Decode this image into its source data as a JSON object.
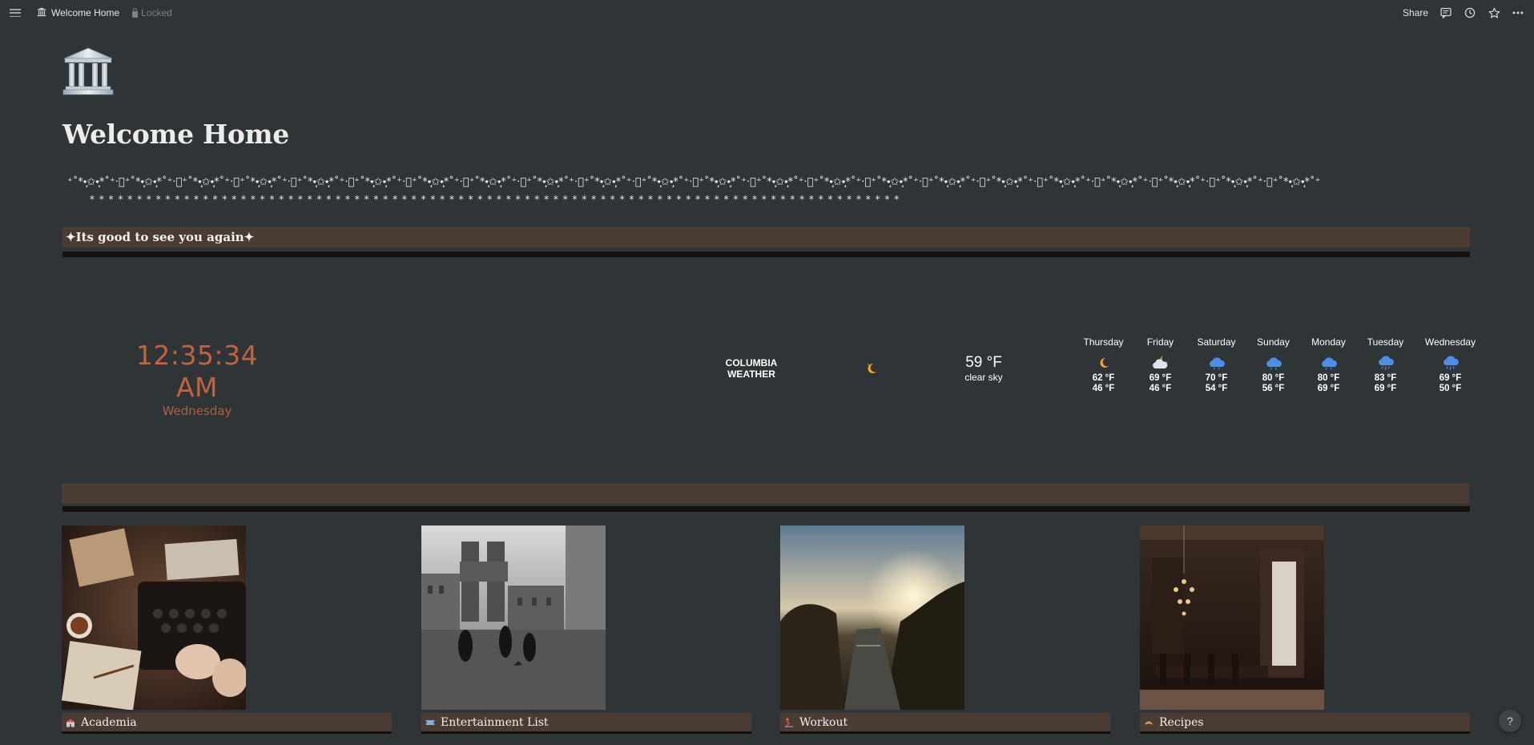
{
  "topbar": {
    "menu_icon": "hamburger-icon",
    "breadcrumb_icon": "classical-building-icon",
    "breadcrumb_title": "Welcome Home",
    "locked_label": "Locked",
    "share_label": "Share",
    "icons": [
      "comment-icon",
      "clock-icon",
      "star-icon",
      "more-icon"
    ]
  },
  "page": {
    "icon": "classical-building-icon",
    "title": "Welcome Home",
    "divider_row1": "⁺˚*•̩̩͙✩•̩̩͙*˚⁺‧͙⁺˚*•̩̩͙✩•̩̩͙*˚⁺‧͙⁺˚*•̩̩͙✩•̩̩͙*˚⁺‧͙⁺˚*•̩̩͙✩•̩̩͙*˚⁺‧͙⁺˚*•̩̩͙✩•̩̩͙*˚⁺‧͙⁺˚*•̩̩͙✩•̩̩͙*˚⁺‧͙⁺˚*•̩̩͙✩•̩̩͙*˚⁺‧͙⁺˚*•̩̩͙✩•̩̩͙*˚⁺‧͙⁺˚*•̩̩͙✩•̩̩͙*˚⁺‧͙⁺˚*•̩̩͙✩•̩̩͙*˚⁺‧͙⁺˚*•̩̩͙✩•̩̩͙*˚⁺‧͙⁺˚*•̩̩͙✩•̩̩͙*˚⁺‧͙⁺˚*•̩̩͙✩•̩̩͙*˚⁺‧͙⁺˚*•̩̩͙✩•̩̩͙*˚⁺‧͙⁺˚*•̩̩͙✩•̩̩͙*˚⁺‧͙⁺˚*•̩̩͙✩•̩̩͙*˚⁺‧͙⁺˚*•̩̩͙✩•̩̩͙*˚⁺‧͙⁺˚*•̩̩͙✩•̩̩͙*˚⁺‧͙⁺˚*•̩̩͙✩•̩̩͙*˚⁺‧͙⁺˚*•̩̩͙✩•̩̩͙*˚⁺‧͙⁺˚*•̩̩͙✩•̩̩͙*˚⁺‧͙⁺˚*•̩̩͙✩•̩̩͙*˚⁺",
    "divider_row2": "⁎ ⁎ ⁎ ⁎ ⁎ ⁎ ⁎ ⁎ ⁎ ⁎ ⁎ ⁎ ⁎ ⁎ ⁎ ⁎ ⁎ ⁎ ⁎ ⁎ ⁎ ⁎ ⁎ ⁎ ⁎ ⁎ ⁎ ⁎ ⁎ ⁎ ⁎ ⁎ ⁎ ⁎ ⁎ ⁎ ⁎ ⁎ ⁎ ⁎ ⁎ ⁎ ⁎ ⁎ ⁎ ⁎ ⁎ ⁎ ⁎ ⁎ ⁎ ⁎ ⁎ ⁎ ⁎ ⁎ ⁎ ⁎ ⁎ ⁎ ⁎ ⁎ ⁎ ⁎ ⁎ ⁎ ⁎ ⁎ ⁎ ⁎ ⁎ ⁎ ⁎ ⁎ ⁎ ⁎ ⁎ ⁎ ⁎ ⁎ ⁎ ⁎ ⁎ ⁎ ⁎ ⁎",
    "greeting": "✦Its good to see you again✦"
  },
  "clock": {
    "time": "12:35:34 AM",
    "day": "Wednesday"
  },
  "weather": {
    "city_line1": "COLUMBIA",
    "city_line2": "WEATHER",
    "current_icon": "crescent-moon-icon",
    "current_temp": "59 °F",
    "current_desc": "clear sky",
    "forecast": [
      {
        "day": "Thursday",
        "icon": "crescent-moon-icon",
        "hi": "62 °F",
        "lo": "46 °F"
      },
      {
        "day": "Friday",
        "icon": "cloud-moon-icon",
        "hi": "69 °F",
        "lo": "46 °F"
      },
      {
        "day": "Saturday",
        "icon": "cloud-icon",
        "hi": "70 °F",
        "lo": "54 °F"
      },
      {
        "day": "Sunday",
        "icon": "cloud-icon",
        "hi": "80 °F",
        "lo": "56 °F"
      },
      {
        "day": "Monday",
        "icon": "cloud-icon",
        "hi": "80 °F",
        "lo": "69 °F"
      },
      {
        "day": "Tuesday",
        "icon": "rain-cloud-icon",
        "hi": "83 °F",
        "lo": "69 °F"
      },
      {
        "day": "Wednesday",
        "icon": "rain-cloud-icon",
        "hi": "69 °F",
        "lo": "50 °F"
      }
    ]
  },
  "gallery": [
    {
      "label": "Academia",
      "icon": "school-icon",
      "image": "typewriter-desk-photo"
    },
    {
      "label": "Entertainment List",
      "icon": "ticket-icon",
      "image": "college-quad-photo"
    },
    {
      "label": "Workout",
      "icon": "rowing-icon",
      "image": "river-sunset-photo"
    },
    {
      "label": "Recipes",
      "icon": "croissant-icon",
      "image": "dining-hall-photo"
    }
  ],
  "help_label": "?",
  "colors": {
    "background": "#2f3437",
    "banner": "#4a3b33",
    "banner_rule": "#15110e",
    "clock_accent": "#c0643f",
    "weather_icon_blue": "#4d8fe8",
    "moon_orange": "#f5a623"
  }
}
